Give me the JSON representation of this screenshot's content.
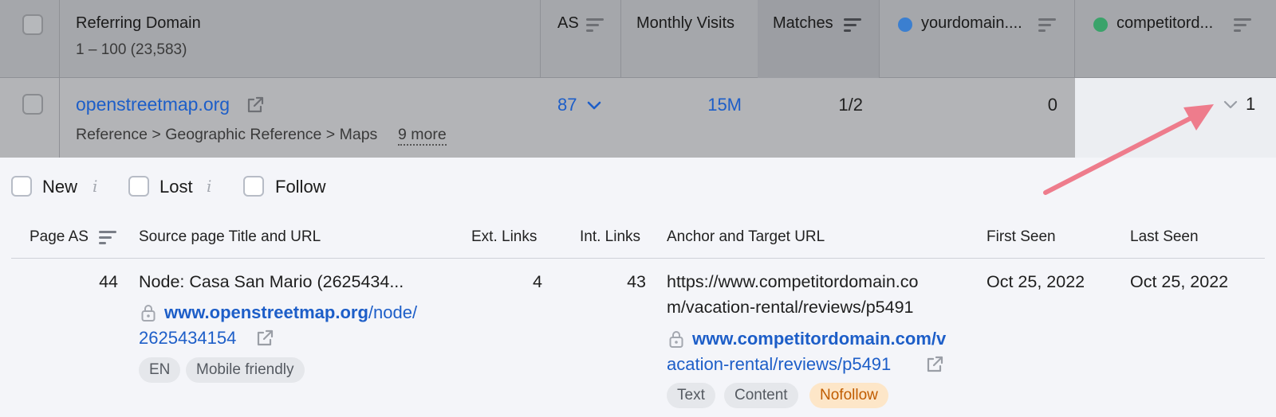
{
  "outer_table": {
    "headers": {
      "referring_domain": "Referring Domain",
      "range_count": "1 – 100 (23,583)",
      "as": "AS",
      "monthly_visits": "Monthly Visits",
      "matches": "Matches",
      "yourdomain": "yourdomain....",
      "competitor": "competitord..."
    },
    "row": {
      "domain": "openstreetmap.org",
      "category": "Reference > Geographic Reference > Maps",
      "more": "9 more",
      "as": "87",
      "visits": "15M",
      "matches": "1/2",
      "yourdomain_count": "0",
      "competitor_count": "1"
    },
    "colors": {
      "yourdomain_dot": "#3b7fd0",
      "competitor_dot": "#3aa36a",
      "link": "#1d5ec8",
      "arrow": "#ee7c8c"
    }
  },
  "filters": [
    {
      "label": "New",
      "info": "i"
    },
    {
      "label": "Lost",
      "info": "i"
    },
    {
      "label": "Follow"
    }
  ],
  "inner_table": {
    "headers": {
      "page_as": "Page AS",
      "source": "Source page Title and URL",
      "ext_links": "Ext. Links",
      "int_links": "Int. Links",
      "anchor": "Anchor and Target URL",
      "first_seen": "First Seen",
      "last_seen": "Last Seen"
    },
    "row": {
      "page_as": "44",
      "title": "Node: Casa San Mario (2625434...",
      "source_url_host": "www.openstreetmap.org",
      "source_url_path1": "/node/",
      "source_url_path2": "2625434154",
      "source_tags": [
        "EN",
        "Mobile friendly"
      ],
      "ext_links": "4",
      "int_links": "43",
      "anchor_line1": "https://www.competitordomain.co",
      "anchor_line2": "m/vacation-rental/reviews/p5491",
      "target_url_line1": "www.competitordomain.com/v",
      "target_url_line2": "acation-rental/reviews/p5491",
      "anchor_tags": [
        "Text",
        "Content",
        "Nofollow"
      ],
      "first_seen": "Oct 25, 2022",
      "last_seen": "Oct 25, 2022"
    }
  }
}
